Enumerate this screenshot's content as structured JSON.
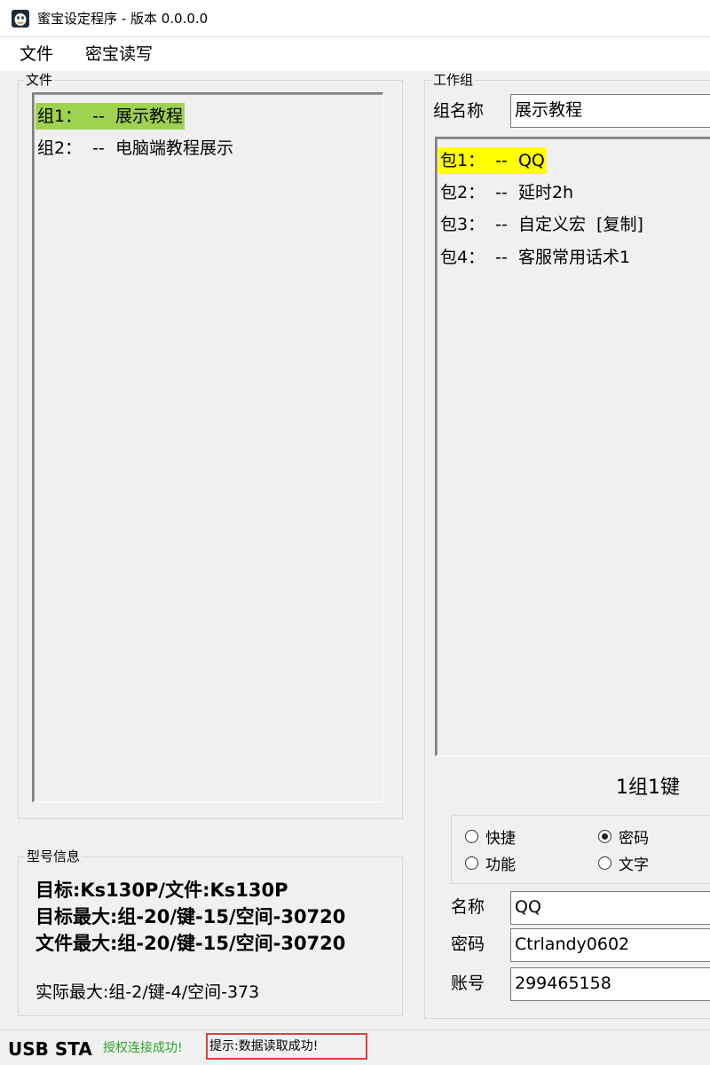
{
  "window": {
    "title": "蜜宝设定程序 - 版本 0.0.0.0"
  },
  "menu": {
    "items": [
      "文件",
      "密宝读写"
    ]
  },
  "file_panel": {
    "label": "文件",
    "groups": [
      {
        "text": "组1：  --  展示教程",
        "selected": true
      },
      {
        "text": "组2：  --  电脑端教程展示",
        "selected": false
      }
    ]
  },
  "work_panel": {
    "label": "工作组",
    "group_name_label": "组名称",
    "group_name_value": "展示教程",
    "packages": [
      {
        "text": "包1：  --  QQ",
        "selected": true
      },
      {
        "text": "包2：  --  延时2h",
        "selected": false
      },
      {
        "text": "包3：  --  自定义宏  [复制]",
        "selected": false
      },
      {
        "text": "包4：  --  客服常用话术1",
        "selected": false
      }
    ],
    "key_info": "1组1键"
  },
  "radio_options": {
    "items": [
      {
        "label": "快捷",
        "checked": false
      },
      {
        "label": "密码",
        "checked": true
      },
      {
        "label": "功能",
        "checked": false
      },
      {
        "label": "文字",
        "checked": false
      }
    ]
  },
  "fields": {
    "name_label": "名称",
    "name_value": "QQ",
    "password_label": "密码",
    "password_value": "Ctrlandy0602",
    "account_label": "账号",
    "account_value": "299465158"
  },
  "model_info": {
    "label": "型号信息",
    "target": "目标:Ks130P/文件:Ks130P",
    "target_max": "目标最大:组-20/键-15/空间-30720",
    "file_max": "文件最大:组-20/键-15/空间-30720",
    "actual_max": "实际最大:组-2/键-4/空间-373"
  },
  "status": {
    "title": "USB STA",
    "auth": "授权连接成功!",
    "hint": "提示:数据读取成功!"
  },
  "colors": {
    "group_selected_bg": "#9ed24f",
    "package_selected_bg": "#ffff00",
    "auth_text": "#2aa52a",
    "hint_border": "#d9403f"
  }
}
